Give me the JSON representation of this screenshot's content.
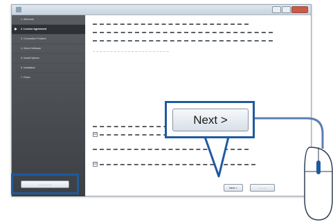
{
  "sidebar": {
    "steps": [
      {
        "label": "1. Welcome"
      },
      {
        "label": "2. License Agreement"
      },
      {
        "label": "3. Connection Problem"
      },
      {
        "label": "4. Select Software"
      },
      {
        "label": "5. Install Options"
      },
      {
        "label": "6. Installation"
      },
      {
        "label": "7. Finish"
      }
    ],
    "active_index": 1,
    "colors": {
      "top": "#595d61",
      "bottom": "#3c4044"
    }
  },
  "buttons": {
    "back_label": "- - - - - - - -",
    "next_label": "Next >",
    "next_small_label": "Next >",
    "cancel_label": "- - - - -"
  },
  "checkboxes": {
    "first_checked": "☑",
    "second_checked": "☑"
  },
  "icons": {
    "app": "app-icon",
    "mouse": "mouse-icon",
    "arrow": "arrow-icon",
    "pointer": "pointer-triangle-icon"
  },
  "colors": {
    "highlight": "#1e5a9e",
    "connector": "#5c7fb3"
  }
}
